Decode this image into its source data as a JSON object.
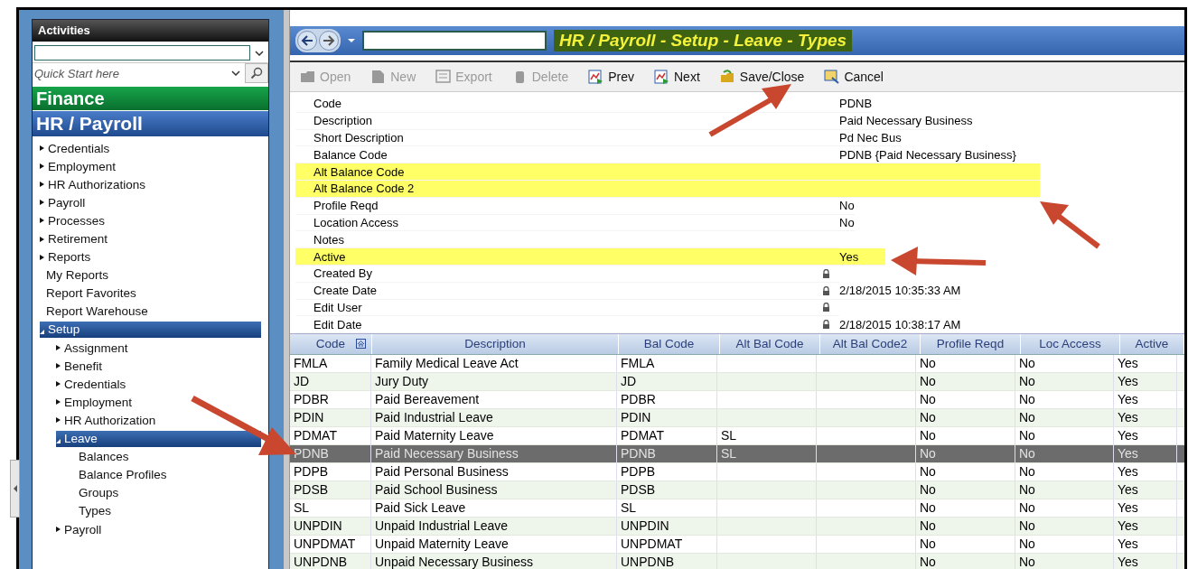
{
  "sidebar": {
    "title": "Activities",
    "search_placeholder": "Quick Start here",
    "modules": [
      {
        "label": "Finance",
        "kind": "finance"
      },
      {
        "label": "HR / Payroll",
        "kind": "hr"
      }
    ],
    "items": [
      {
        "label": "Credentials",
        "expanded": false
      },
      {
        "label": "Employment",
        "expanded": false
      },
      {
        "label": "HR Authorizations",
        "expanded": false
      },
      {
        "label": "Payroll",
        "expanded": false
      },
      {
        "label": "Processes",
        "expanded": false
      },
      {
        "label": "Retirement",
        "expanded": false
      },
      {
        "label": "Reports",
        "expanded": false
      },
      {
        "label": "My Reports"
      },
      {
        "label": "Report Favorites"
      },
      {
        "label": "Report Warehouse"
      },
      {
        "label": "Setup",
        "expanded": true,
        "children": [
          {
            "label": "Assignment",
            "expanded": false
          },
          {
            "label": "Benefit",
            "expanded": false
          },
          {
            "label": "Credentials",
            "expanded": false
          },
          {
            "label": "Employment",
            "expanded": false
          },
          {
            "label": "HR Authorization",
            "expanded": false
          },
          {
            "label": "Leave",
            "expanded": true,
            "children": [
              {
                "label": "Balances"
              },
              {
                "label": "Balance Profiles"
              },
              {
                "label": "Groups"
              },
              {
                "label": "Types"
              }
            ]
          },
          {
            "label": "Payroll",
            "expanded": false
          }
        ]
      }
    ]
  },
  "window": {
    "title": "HR / Payroll - Setup - Leave - Types"
  },
  "toolbar": [
    {
      "label": "Open",
      "kind": "open",
      "disabled": true
    },
    {
      "label": "New",
      "kind": "new",
      "disabled": true
    },
    {
      "label": "Export",
      "kind": "export",
      "disabled": true
    },
    {
      "label": "Delete",
      "kind": "delete",
      "disabled": true
    },
    {
      "label": "Prev",
      "kind": "prev",
      "disabled": false
    },
    {
      "label": "Next",
      "kind": "next",
      "disabled": false
    },
    {
      "label": "Save/Close",
      "kind": "save",
      "disabled": false
    },
    {
      "label": "Cancel",
      "kind": "cancel",
      "disabled": false
    }
  ],
  "details": [
    {
      "label": "Code",
      "value": "PDNB",
      "locked": false,
      "highlighted": false
    },
    {
      "label": "Description",
      "value": "Paid Necessary Business",
      "locked": false,
      "highlighted": false
    },
    {
      "label": "Short Description",
      "value": "Pd Nec Bus",
      "locked": false,
      "highlighted": false
    },
    {
      "label": "Balance Code",
      "value": "PDNB {Paid Necessary Business}",
      "locked": false,
      "highlighted": false
    },
    {
      "label": "Alt Balance Code",
      "locked": false,
      "highlighted": true
    },
    {
      "label": "Alt Balance Code 2",
      "locked": false,
      "highlighted": true
    },
    {
      "label": "Profile Reqd",
      "value": "No",
      "locked": false,
      "highlighted": false
    },
    {
      "label": "Location Access",
      "value": "No",
      "locked": false,
      "highlighted": false
    },
    {
      "label": "Notes",
      "locked": false,
      "highlighted": false
    },
    {
      "label": "Active",
      "value": "Yes",
      "locked": false,
      "highlighted": true
    },
    {
      "label": "Created By",
      "locked": true,
      "highlighted": false
    },
    {
      "label": "Create Date",
      "value": "2/18/2015 10:35:33 AM",
      "locked": true,
      "highlighted": false
    },
    {
      "label": "Edit User",
      "locked": true,
      "highlighted": false
    },
    {
      "label": "Edit Date",
      "value": "2/18/2015 10:38:17 AM",
      "locked": true,
      "highlighted": false
    }
  ],
  "table": {
    "columns": [
      "Code",
      "Description",
      "Bal Code",
      "Alt Bal Code",
      "Alt Bal Code2",
      "Profile Reqd",
      "Loc Access",
      "Active"
    ],
    "rows": [
      {
        "cells": [
          "FMLA",
          "Family Medical Leave Act",
          "FMLA",
          "",
          "",
          "No",
          "No",
          "Yes"
        ],
        "selected": false
      },
      {
        "cells": [
          "JD",
          "Jury Duty",
          "JD",
          "",
          "",
          "No",
          "No",
          "Yes"
        ],
        "selected": false
      },
      {
        "cells": [
          "PDBR",
          "Paid Bereavement",
          "PDBR",
          "",
          "",
          "No",
          "No",
          "Yes"
        ],
        "selected": false
      },
      {
        "cells": [
          "PDIN",
          "Paid Industrial Leave",
          "PDIN",
          "",
          "",
          "No",
          "No",
          "Yes"
        ],
        "selected": false
      },
      {
        "cells": [
          "PDMAT",
          "Paid Maternity Leave",
          "PDMAT",
          "SL",
          "",
          "No",
          "No",
          "Yes"
        ],
        "selected": false
      },
      {
        "cells": [
          "PDNB",
          "Paid Necessary Business",
          "PDNB",
          "SL",
          "",
          "No",
          "No",
          "Yes"
        ],
        "selected": true
      },
      {
        "cells": [
          "PDPB",
          "Paid Personal Business",
          "PDPB",
          "",
          "",
          "No",
          "No",
          "Yes"
        ],
        "selected": false
      },
      {
        "cells": [
          "PDSB",
          "Paid School Business",
          "PDSB",
          "",
          "",
          "No",
          "No",
          "Yes"
        ],
        "selected": false
      },
      {
        "cells": [
          "SL",
          "Paid Sick Leave",
          "SL",
          "",
          "",
          "No",
          "No",
          "Yes"
        ],
        "selected": false
      },
      {
        "cells": [
          "UNPDIN",
          "Unpaid Industrial Leave",
          "UNPDIN",
          "",
          "",
          "No",
          "No",
          "Yes"
        ],
        "selected": false
      },
      {
        "cells": [
          "UNPDMAT",
          "Unpaid Maternity Leave",
          "UNPDMAT",
          "",
          "",
          "No",
          "No",
          "Yes"
        ],
        "selected": false
      },
      {
        "cells": [
          "UNPDNB",
          "Unpaid Necessary Business",
          "UNPDNB",
          "",
          "",
          "No",
          "No",
          "Yes"
        ],
        "selected": false
      }
    ]
  }
}
